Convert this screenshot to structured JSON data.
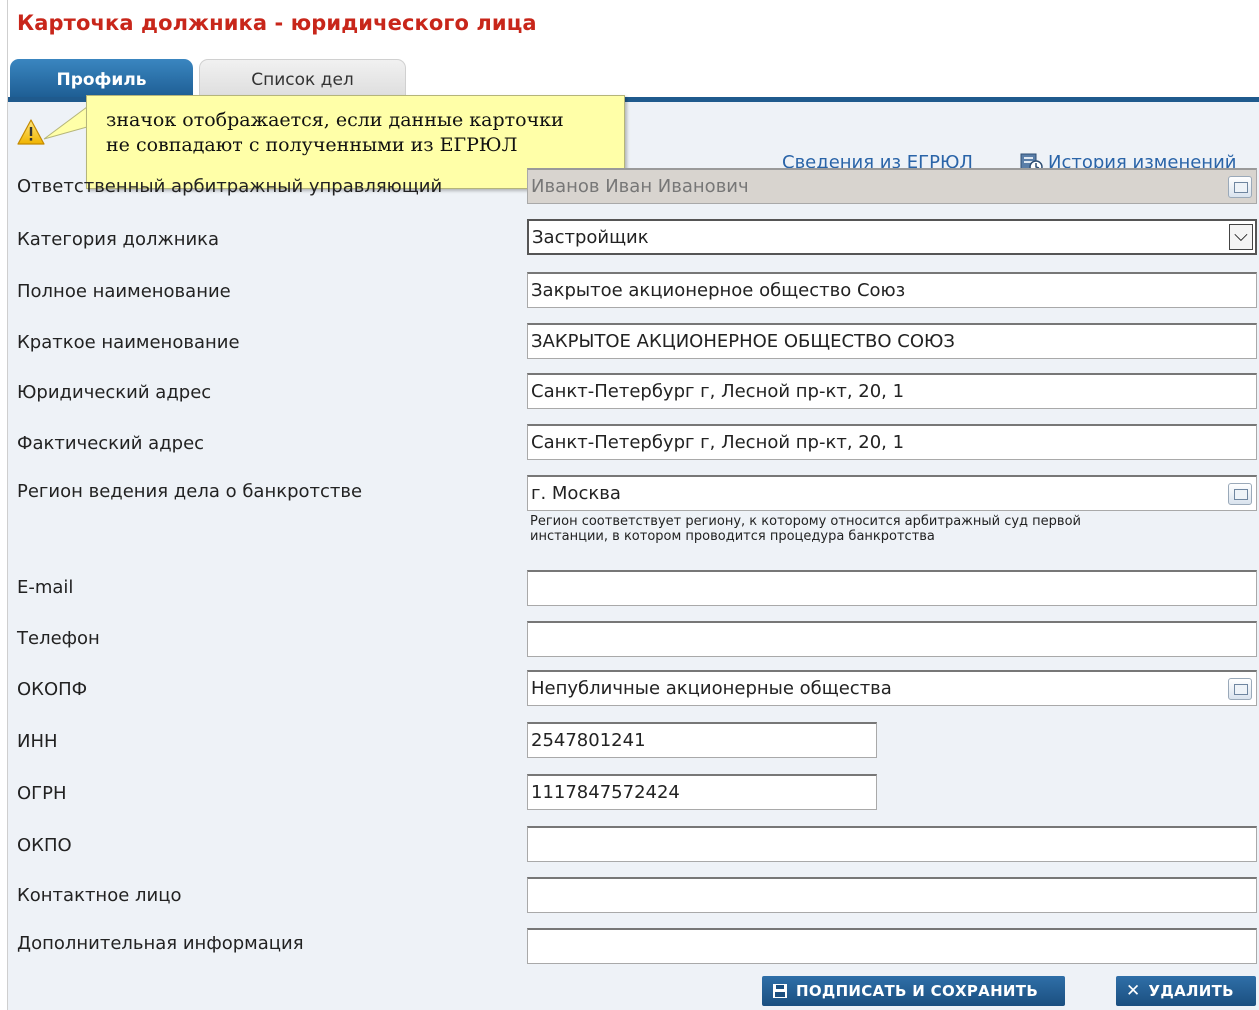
{
  "title": "Карточка должника - юридического лица",
  "tabs": [
    {
      "label": "Профиль",
      "active": true
    },
    {
      "label": "Список дел",
      "active": false
    }
  ],
  "callout": {
    "line1": "значок отображается, если данные карточки",
    "line2": "не совпадают с полученными из ЕГРЮЛ"
  },
  "links": {
    "egrul": "Сведения из ЕГРЮЛ",
    "history": "История изменений"
  },
  "fields": [
    {
      "label": "Ответственный арбитражный управляющий",
      "value": "Иванов Иван Иванович"
    },
    {
      "label": "Категория должника",
      "value": "Застройщик"
    },
    {
      "label": "Полное наименование",
      "value": "Закрытое акционерное общество Союз"
    },
    {
      "label": "Краткое наименование",
      "value": "ЗАКРЫТОЕ АКЦИОНЕРНОЕ ОБЩЕСТВО СОЮЗ"
    },
    {
      "label": "Юридический адрес",
      "value": "Санкт-Петербург г, Лесной пр-кт, 20, 1"
    },
    {
      "label": "Фактический адрес",
      "value": "Санкт-Петербург г, Лесной пр-кт, 20, 1"
    },
    {
      "label": "Регион ведения дела о банкротстве",
      "value": "г. Москва"
    },
    {
      "label": "E-mail",
      "value": ""
    },
    {
      "label": "Телефон",
      "value": ""
    },
    {
      "label": "ОКОПФ",
      "value": "Непубличные акционерные общества"
    },
    {
      "label": "ИНН",
      "value": "2547801241"
    },
    {
      "label": "ОГРН",
      "value": "1117847572424"
    },
    {
      "label": "ОКПО",
      "value": ""
    },
    {
      "label": "Контактное лицо",
      "value": ""
    },
    {
      "label": "Дополнительная информация",
      "value": ""
    }
  ],
  "region_hint": {
    "line1": "Регион соответствует региону, к которому относится арбитражный суд первой",
    "line2": "инстанции, в котором проводится процедура банкротства"
  },
  "buttons": {
    "save": "ПОДПИСАТЬ И СОХРАНИТЬ",
    "delete": "УДАЛИТЬ"
  },
  "colors": {
    "title": "#c8261a",
    "tab_active": "#1f5a8d",
    "link": "#2a64a8",
    "content_bg": "#eef2f7",
    "callout_bg": "#ffffa8"
  }
}
